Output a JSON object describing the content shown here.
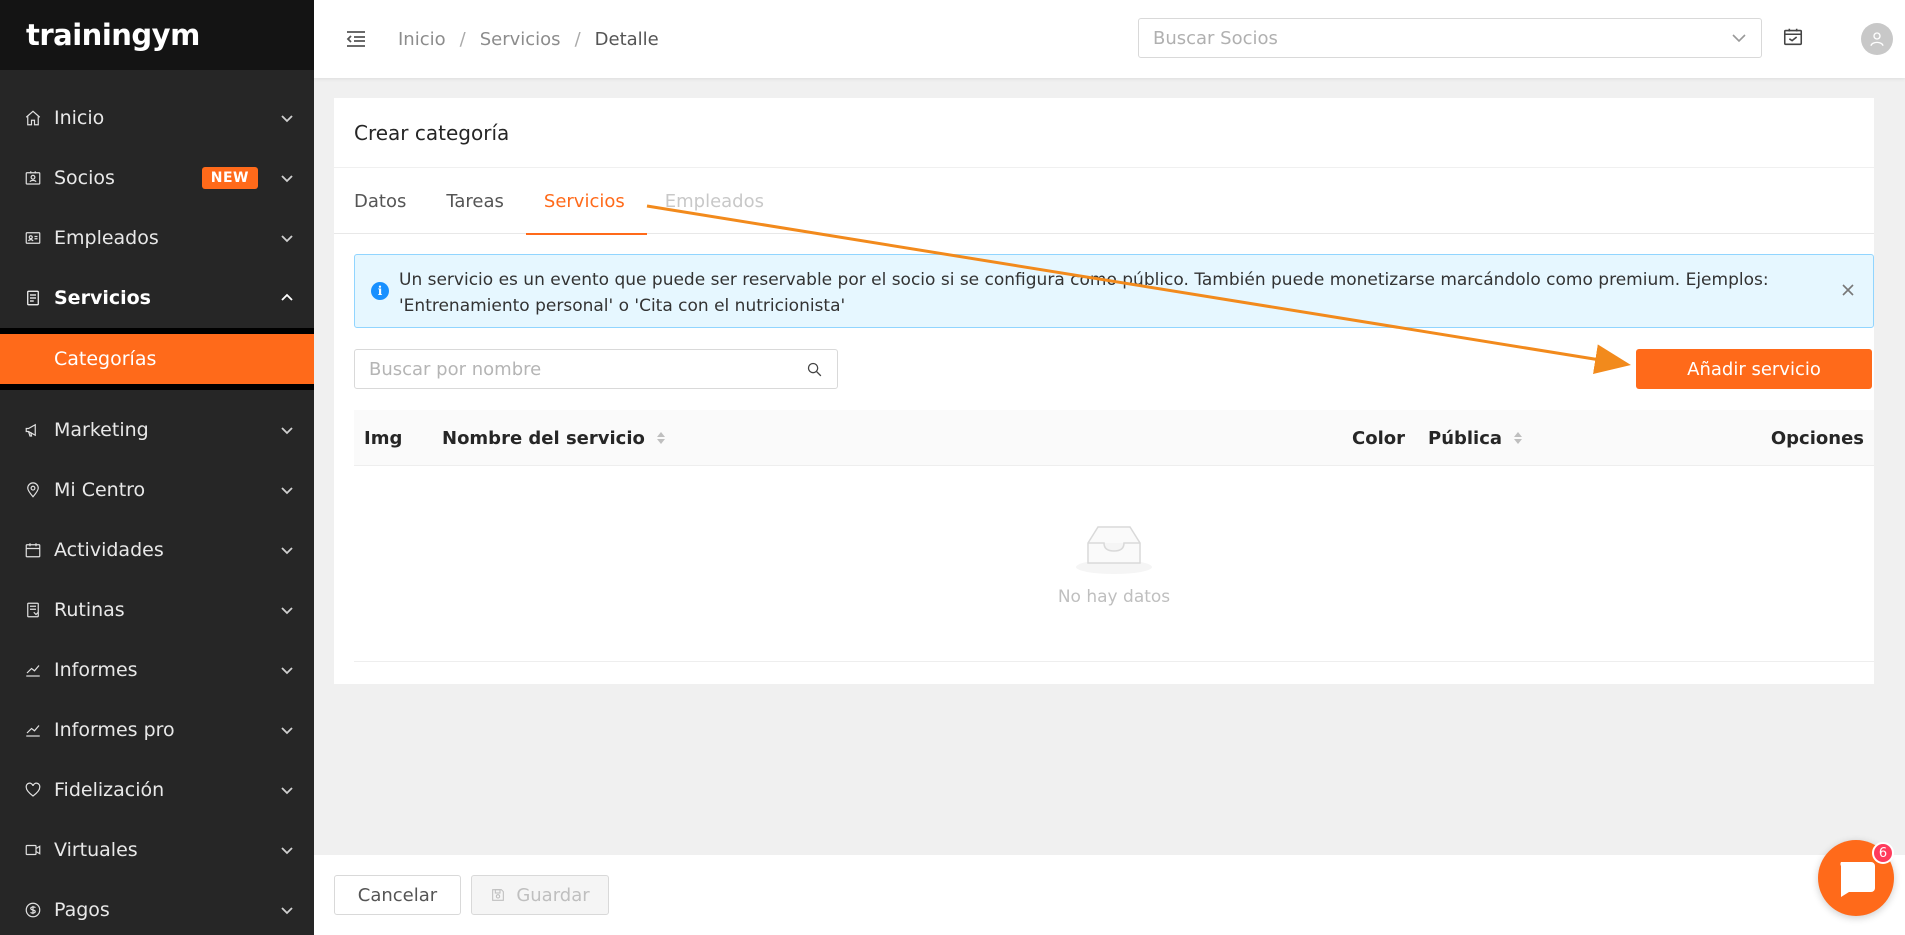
{
  "app": {
    "logo_text": "trainingym"
  },
  "sidebar": {
    "items": [
      {
        "label": "Inicio",
        "icon": "home-icon"
      },
      {
        "label": "Socios",
        "icon": "id-card-icon",
        "badge": "NEW"
      },
      {
        "label": "Empleados",
        "icon": "contact-card-icon"
      },
      {
        "label": "Servicios",
        "icon": "clipboard-icon",
        "expanded": true
      }
    ],
    "sub_items": [
      {
        "label": "Categorías",
        "active": true
      }
    ],
    "items_after": [
      {
        "label": "Marketing",
        "icon": "megaphone-icon"
      },
      {
        "label": "Mi Centro",
        "icon": "location-pin-icon"
      },
      {
        "label": "Actividades",
        "icon": "calendar-icon"
      },
      {
        "label": "Rutinas",
        "icon": "book-icon"
      },
      {
        "label": "Informes",
        "icon": "line-chart-icon"
      },
      {
        "label": "Informes pro",
        "icon": "line-chart-icon"
      },
      {
        "label": "Fidelización",
        "icon": "heart-icon"
      },
      {
        "label": "Virtuales",
        "icon": "video-icon"
      },
      {
        "label": "Pagos",
        "icon": "dollar-circle-icon"
      }
    ]
  },
  "header": {
    "breadcrumb": [
      "Inicio",
      "Servicios",
      "Detalle"
    ],
    "breadcrumb_sep": "/",
    "search_placeholder": "Buscar Socios"
  },
  "card": {
    "title": "Crear categoría",
    "tabs": [
      {
        "label": "Datos",
        "state": "normal"
      },
      {
        "label": "Tareas",
        "state": "normal"
      },
      {
        "label": "Servicios",
        "state": "active"
      },
      {
        "label": "Empleados",
        "state": "disabled"
      }
    ],
    "alert_text": "Un servicio es un evento que puede ser reservable por el socio si se configura como público. También puede monetizarse marcándolo como premium. Ejemplos: 'Entrenamiento personal' o 'Cita con el nutricionista'",
    "search_placeholder": "Buscar por nombre",
    "add_button": "Añadir servicio",
    "table": {
      "columns": [
        "Img",
        "Nombre del servicio",
        "Color",
        "Pública",
        "Opciones"
      ]
    },
    "empty_text": "No hay datos"
  },
  "footer": {
    "cancel": "Cancelar",
    "save": "Guardar"
  },
  "chat": {
    "badge": "6"
  },
  "colors": {
    "accent": "#ff6a1a",
    "sidebar_bg": "#262626",
    "info_bg": "#e6f7ff",
    "info_border": "#91d5ff",
    "annotation_arrow": "#f28a1c"
  }
}
